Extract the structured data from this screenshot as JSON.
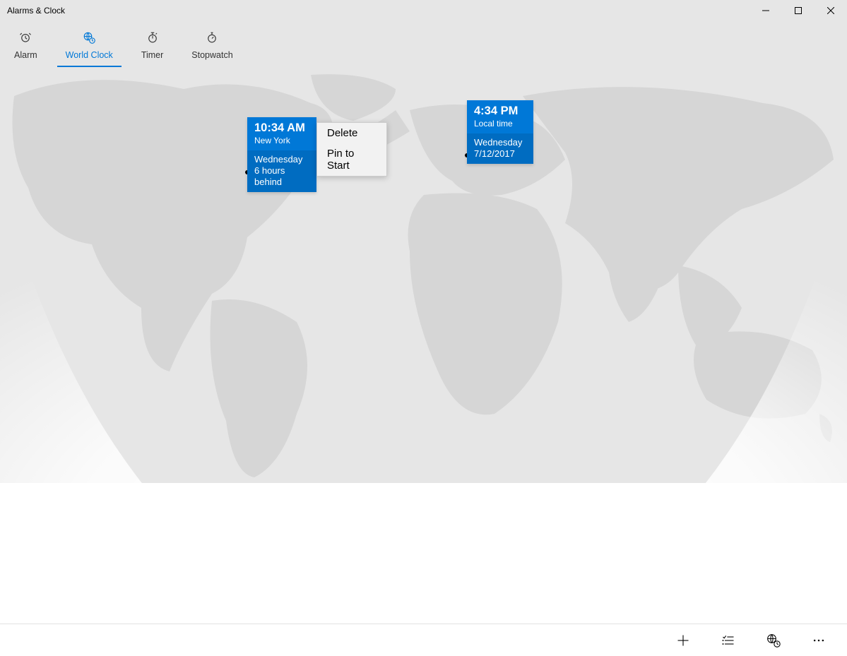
{
  "window": {
    "title": "Alarms & Clock"
  },
  "tabs": {
    "alarm": "Alarm",
    "world_clock": "World Clock",
    "timer": "Timer",
    "stopwatch": "Stopwatch",
    "selected": "world_clock"
  },
  "clocks": [
    {
      "time": "10:34 AM",
      "location": "New York",
      "day": "Wednesday",
      "offset": "6 hours behind"
    },
    {
      "time": "4:34 PM",
      "location": "Local time",
      "day": "Wednesday",
      "offset": "7/12/2017"
    }
  ],
  "context_menu": {
    "items": [
      "Delete",
      "Pin to Start"
    ]
  },
  "commands": {
    "add": "Add new clock",
    "select": "Select clocks",
    "convert": "Convert time",
    "more": "More"
  }
}
